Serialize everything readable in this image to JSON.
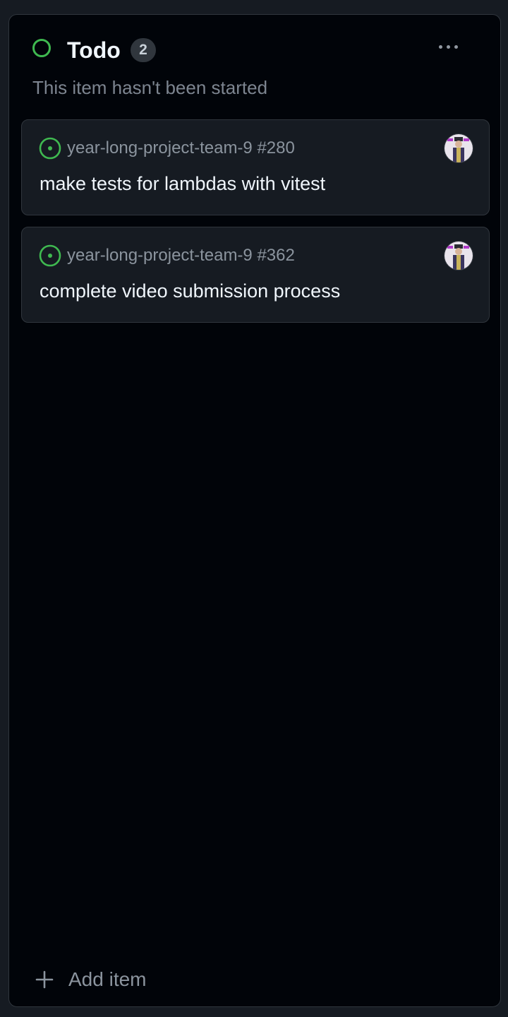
{
  "column": {
    "title": "Todo",
    "count": "2",
    "subtitle": "This item hasn't been started",
    "status_color": "#3fb950",
    "more_icon": "kebab-horizontal-icon"
  },
  "cards": [
    {
      "repo_ref": "year-long-project-team-9 #280",
      "title": "make tests for lambdas with vitest",
      "status_icon": "issue-opened-icon",
      "status_color": "#3fb950"
    },
    {
      "repo_ref": "year-long-project-team-9 #362",
      "title": "complete video submission process",
      "status_icon": "issue-opened-icon",
      "status_color": "#3fb950"
    }
  ],
  "footer": {
    "add_label": "Add item",
    "add_icon": "plus-icon"
  },
  "colors": {
    "background": "#161b22",
    "column_bg": "#010409",
    "card_bg": "#161b22",
    "border": "#30363d",
    "text_primary": "#f0f6fc",
    "text_muted": "#8b949e"
  }
}
